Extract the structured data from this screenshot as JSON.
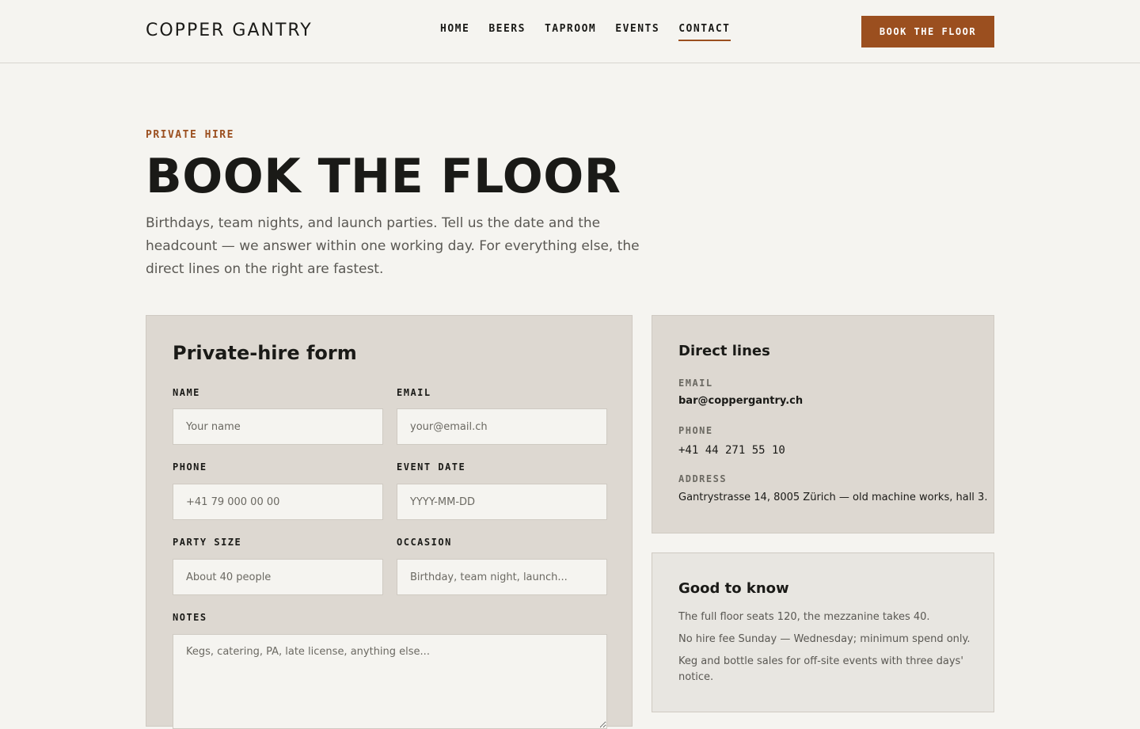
{
  "header": {
    "logo": "COPPER GANTRY",
    "nav": [
      "HOME",
      "BEERS",
      "TAPROOM",
      "EVENTS",
      "CONTACT"
    ],
    "active_nav": "CONTACT",
    "cta_label": "BOOK THE FLOOR"
  },
  "hero": {
    "eyebrow": "PRIVATE HIRE",
    "title": "BOOK THE FLOOR",
    "intro": "Birthdays, team nights, and launch parties. Tell us the date and the headcount — we answer within one working day. For everything else, the direct lines on the right are fastest."
  },
  "form": {
    "title": "Private-hire form",
    "fields": {
      "name": {
        "label": "NAME",
        "placeholder": "Your name"
      },
      "email": {
        "label": "EMAIL",
        "placeholder": "your@email.ch"
      },
      "phone": {
        "label": "PHONE",
        "placeholder": "+41 79 000 00 00"
      },
      "event_date": {
        "label": "EVENT DATE",
        "placeholder": "YYYY-MM-DD"
      },
      "party_size": {
        "label": "PARTY SIZE",
        "placeholder": "About 40 people"
      },
      "occasion": {
        "label": "OCCASION",
        "placeholder": "Birthday, team night, launch..."
      },
      "notes": {
        "label": "NOTES",
        "placeholder": "Kegs, catering, PA, late license, anything else..."
      }
    }
  },
  "direct_lines": {
    "title": "Direct lines",
    "email_label": "EMAIL",
    "email": "bar@coppergantry.ch",
    "phone_label": "PHONE",
    "phone": "+41 44 271 55 10",
    "address_label": "ADDRESS",
    "address": "Gantrystrasse 14, 8005 Zürich — old machine works, hall 3."
  },
  "good_to_know": {
    "title": "Good to know",
    "items": [
      "The full floor seats 120, the mezzanine takes 40.",
      "No hire fee Sunday — Wednesday; minimum spend only.",
      "Keg and bottle sales for off-site events with three days' notice."
    ]
  },
  "colors": {
    "accent": "#9b4f1f",
    "background": "#f5f4f0",
    "card": "#ddd8d1"
  }
}
